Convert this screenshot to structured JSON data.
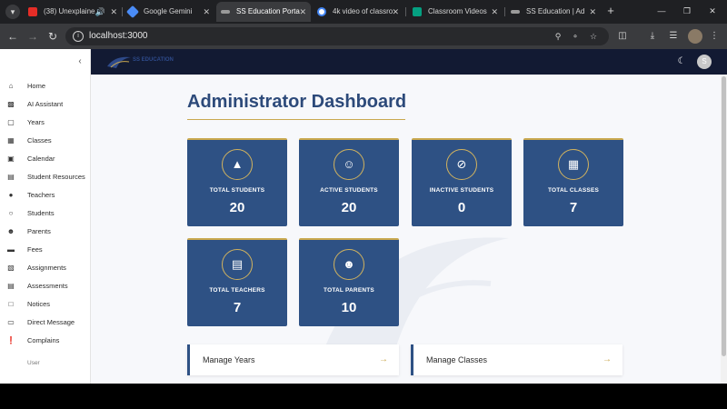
{
  "tabs": [
    {
      "title": "(38) Unexplaine",
      "icon": "youtube-icon",
      "color": "#e52d27"
    },
    {
      "title": "Google Gemini",
      "icon": "gemini-icon",
      "color": "#4a8cf7"
    },
    {
      "title": "SS Education Porta",
      "icon": "ss-logo-icon",
      "color": "#9a9a9a",
      "active": true
    },
    {
      "title": "4k video of classro",
      "icon": "google-icon",
      "color": "#ffffff"
    },
    {
      "title": "Classroom Videos",
      "icon": "pexels-icon",
      "color": "#05a081"
    },
    {
      "title": "SS Education | Ad",
      "icon": "ss-logo-icon",
      "color": "#9a9a9a"
    }
  ],
  "address_bar": {
    "url": "localhost:3000"
  },
  "brand": {
    "logo_text": "SS EDUCATION",
    "accent": "#c9a84f",
    "primary": "#2e5184",
    "topbar": "#121a33"
  },
  "user": {
    "avatar_letter": "S"
  },
  "sidebar": {
    "items": [
      {
        "label": "Home",
        "icon": "home-icon"
      },
      {
        "label": "AI Assistant",
        "icon": "robot-icon"
      },
      {
        "label": "Years",
        "icon": "calendar-book-icon"
      },
      {
        "label": "Classes",
        "icon": "book-open-icon"
      },
      {
        "label": "Calendar",
        "icon": "calendar-icon"
      },
      {
        "label": "Student Resources",
        "icon": "book-icon"
      },
      {
        "label": "Teachers",
        "icon": "users-icon"
      },
      {
        "label": "Students",
        "icon": "user-icon"
      },
      {
        "label": "Parents",
        "icon": "family-icon"
      },
      {
        "label": "Fees",
        "icon": "card-icon"
      },
      {
        "label": "Assignments",
        "icon": "clipboard-icon"
      },
      {
        "label": "Assessments",
        "icon": "document-icon"
      },
      {
        "label": "Notices",
        "icon": "notice-icon"
      },
      {
        "label": "Direct Message",
        "icon": "chat-icon"
      },
      {
        "label": "Complains",
        "icon": "alert-icon"
      }
    ],
    "section_label": "User"
  },
  "main": {
    "title": "Administrator Dashboard",
    "stats": [
      {
        "label": "TOTAL STUDENTS",
        "value": "20",
        "icon": "graduation-cap-icon"
      },
      {
        "label": "ACTIVE STUDENTS",
        "value": "20",
        "icon": "person-icon"
      },
      {
        "label": "INACTIVE STUDENTS",
        "value": "0",
        "icon": "person-off-icon"
      },
      {
        "label": "TOTAL CLASSES",
        "value": "7",
        "icon": "book-icon"
      },
      {
        "label": "TOTAL TEACHERS",
        "value": "7",
        "icon": "teacher-book-icon"
      },
      {
        "label": "TOTAL PARENTS",
        "value": "10",
        "icon": "parents-icon"
      }
    ],
    "manage_links": [
      {
        "label": "Manage Years"
      },
      {
        "label": "Manage Classes"
      }
    ]
  }
}
